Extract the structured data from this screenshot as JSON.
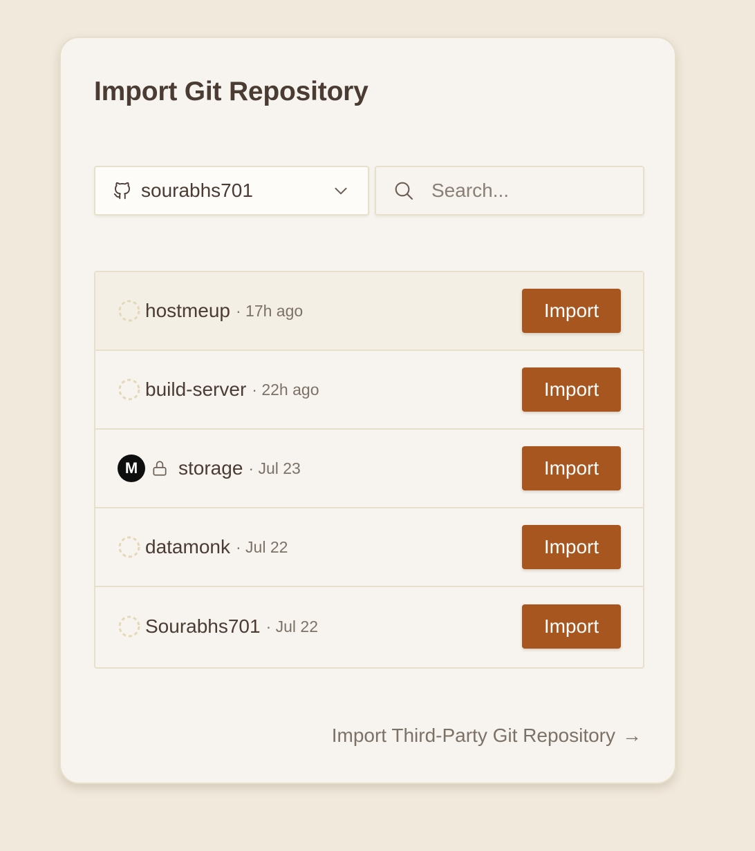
{
  "title": "Import Git Repository",
  "account": {
    "name": "sourabhs701",
    "icon": "github-icon"
  },
  "search": {
    "placeholder": "Search..."
  },
  "repos": [
    {
      "name": "hostmeup",
      "time": "17h ago",
      "icon": "dashed-circle",
      "private": false,
      "button": "Import"
    },
    {
      "name": "build-server",
      "time": "22h ago",
      "icon": "dashed-circle",
      "private": false,
      "button": "Import"
    },
    {
      "name": "storage",
      "time": "Jul 23",
      "icon": "avatar",
      "avatar_letter": "M",
      "private": true,
      "button": "Import"
    },
    {
      "name": "datamonk",
      "time": "Jul 22",
      "icon": "dashed-circle",
      "private": false,
      "button": "Import"
    },
    {
      "name": "Sourabhs701",
      "time": "Jul 22",
      "icon": "dashed-circle",
      "private": false,
      "button": "Import"
    }
  ],
  "third_party_link": {
    "label": "Import Third-Party Git Repository",
    "arrow": "→"
  },
  "colors": {
    "background": "#f1e9dc",
    "card": "#f7f4ef",
    "border": "#e6dfca",
    "accent": "#a8561f",
    "text": "#4a3b33",
    "muted": "#7c7166"
  }
}
